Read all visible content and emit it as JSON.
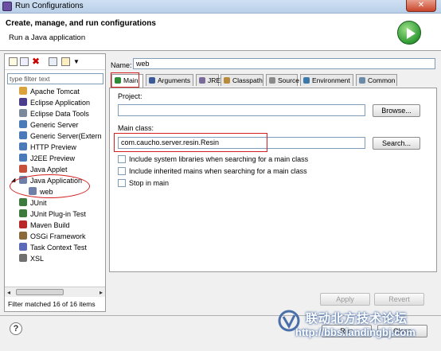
{
  "window": {
    "title": "Run Configurations",
    "close_glyph": "✕"
  },
  "banner": {
    "heading": "Create, manage, and run configurations",
    "subtitle": "Run a Java application",
    "icon": "run-play-icon"
  },
  "sidebar": {
    "filter_placeholder": "type filter text",
    "items": [
      {
        "label": "Apache Tomcat",
        "icon": "tomcat-icon",
        "color": "#d9a23a"
      },
      {
        "label": "Eclipse Application",
        "icon": "eclipse-icon",
        "color": "#4b3c8c"
      },
      {
        "label": "Eclipse Data Tools",
        "icon": "data-tools-icon",
        "color": "#7a8a9a"
      },
      {
        "label": "Generic Server",
        "icon": "server-icon",
        "color": "#4a7ab8"
      },
      {
        "label": "Generic Server(Extern",
        "icon": "server-icon",
        "color": "#4a7ab8"
      },
      {
        "label": "HTTP Preview",
        "icon": "server-icon",
        "color": "#4a7ab8"
      },
      {
        "label": "J2EE Preview",
        "icon": "server-icon",
        "color": "#4a7ab8"
      },
      {
        "label": "Java Applet",
        "icon": "applet-icon",
        "color": "#c7503a"
      },
      {
        "label": "Java Application",
        "icon": "java-app-icon",
        "color": "#6e7fa8"
      },
      {
        "label": "web",
        "icon": "java-config-icon",
        "color": "#6e7fa8"
      },
      {
        "label": "JUnit",
        "icon": "junit-icon",
        "color": "#3d7a3d"
      },
      {
        "label": "JUnit Plug-in Test",
        "icon": "junit-plugin-icon",
        "color": "#3d7a3d"
      },
      {
        "label": "Maven Build",
        "icon": "maven-icon",
        "color": "#b82828"
      },
      {
        "label": "OSGi Framework",
        "icon": "osgi-icon",
        "color": "#8a6a3a"
      },
      {
        "label": "Task Context Test",
        "icon": "task-icon",
        "color": "#5a6ab8"
      },
      {
        "label": "XSL",
        "icon": "xsl-icon",
        "color": "#707070"
      }
    ],
    "status": "Filter matched 16 of 16 items"
  },
  "config": {
    "name_label": "Name:",
    "name_value": "web",
    "tabs": [
      {
        "label": "Main",
        "icon": "main-tab-icon",
        "color": "#2e8a34"
      },
      {
        "label": "Arguments",
        "icon": "arguments-icon",
        "color": "#3a5a9a"
      },
      {
        "label": "JRE",
        "icon": "jre-icon",
        "color": "#7a6a9a"
      },
      {
        "label": "Classpath",
        "icon": "classpath-icon",
        "color": "#b88a3a"
      },
      {
        "label": "Source",
        "icon": "source-icon",
        "color": "#8a8a8a"
      },
      {
        "label": "Environment",
        "icon": "environment-icon",
        "color": "#3a7aaa"
      },
      {
        "label": "Common",
        "icon": "common-icon",
        "color": "#6a8aaa"
      }
    ],
    "project_label": "Project:",
    "project_value": "",
    "browse_label": "Browse...",
    "main_class_label": "Main class:",
    "main_class_value": "com.caucho.server.resin.Resin",
    "search_label": "Search...",
    "options": [
      {
        "label": "Include system libraries when searching for a main class",
        "checked": false
      },
      {
        "label": "Include inherited mains when searching for a main class",
        "checked": false
      },
      {
        "label": "Stop in main",
        "checked": false
      }
    ],
    "apply_label": "Apply",
    "revert_label": "Revert"
  },
  "footer": {
    "run_label": "Run",
    "close_label": "Close",
    "help_glyph": "?"
  },
  "watermark": {
    "cn_text": "联动北方技术论坛",
    "url_text": "http://bbs.landingbj.com"
  }
}
